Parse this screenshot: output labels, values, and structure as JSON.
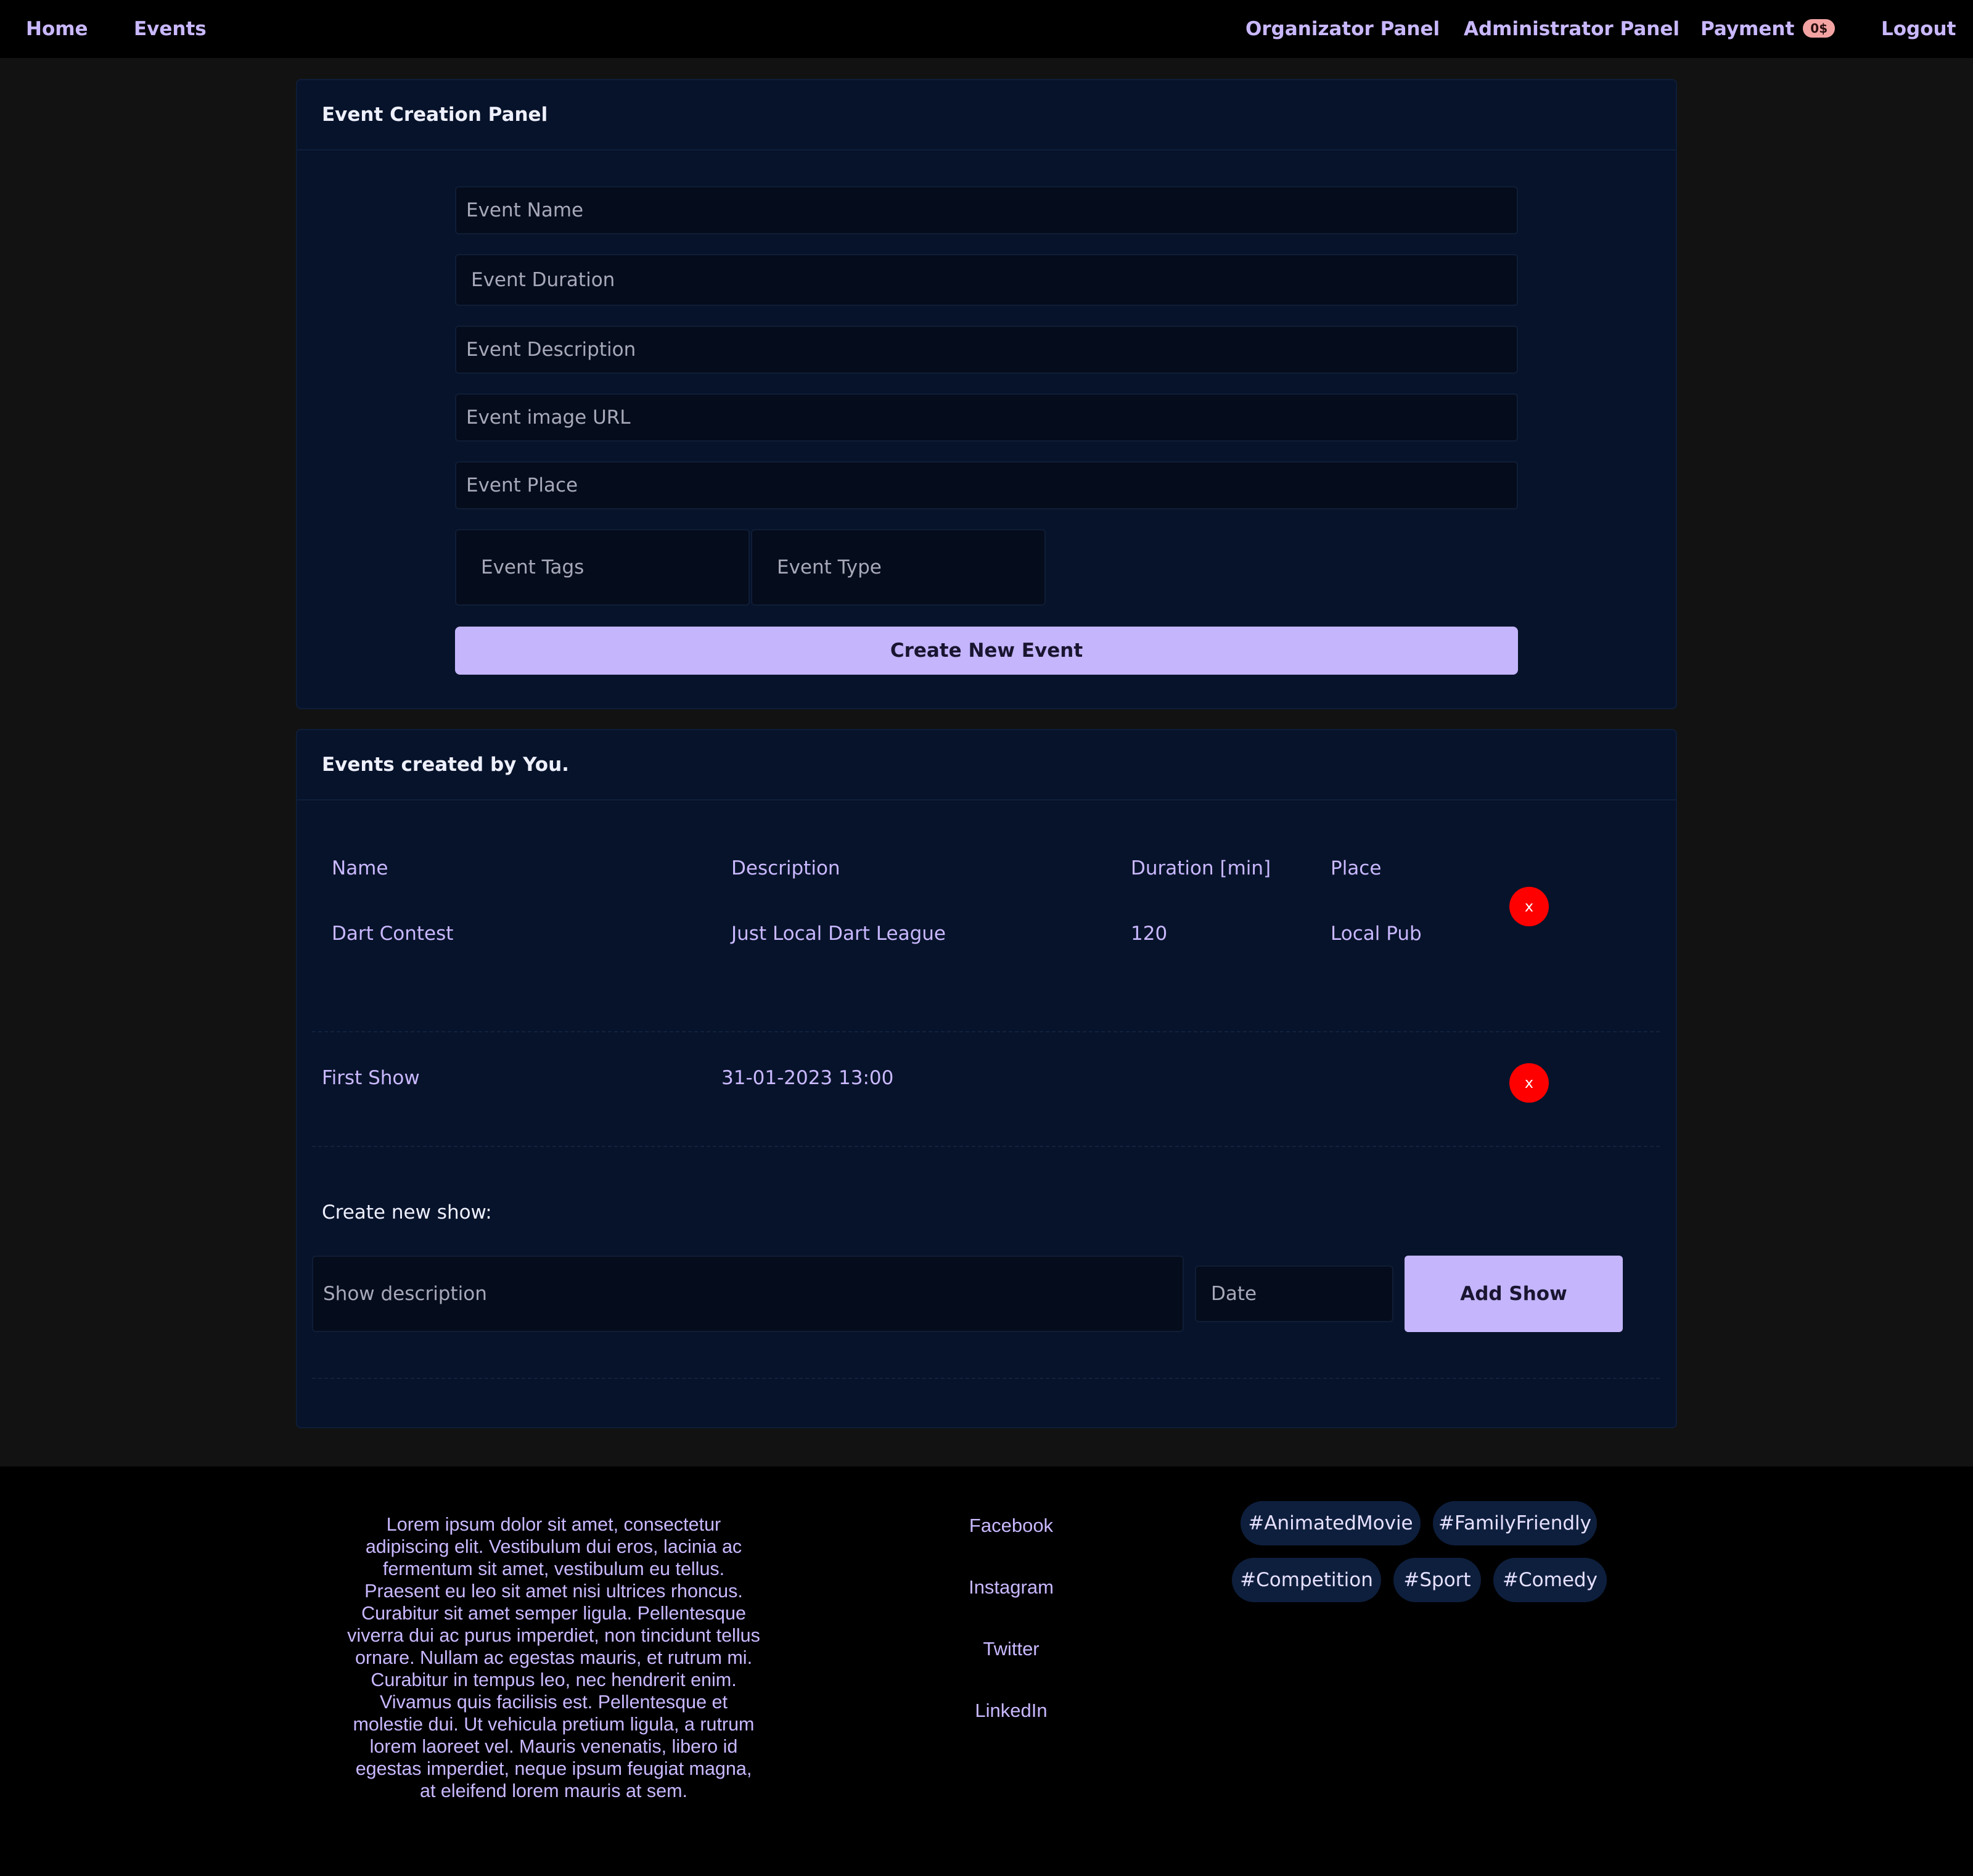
{
  "nav": {
    "home": "Home",
    "events": "Events",
    "organizator_panel": "Organizator Panel",
    "administrator_panel": "Administrator Panel",
    "payment": "Payment",
    "payment_badge": "0$",
    "logout": "Logout"
  },
  "creation_panel": {
    "title": "Event Creation Panel",
    "placeholders": {
      "name": "Event Name",
      "duration": "Event Duration",
      "description": "Event Description",
      "image_url": "Event image URL",
      "place": "Event Place",
      "tags": "Event Tags",
      "type": "Event Type"
    },
    "submit_label": "Create New Event"
  },
  "events_panel": {
    "title": "Events created by You.",
    "columns": [
      "Name",
      "Description",
      "Duration [min]",
      "Place"
    ],
    "event": {
      "name": "Dart Contest",
      "description": "Just Local Dart League",
      "duration": "120",
      "place": "Local Pub"
    },
    "delete_label": "x",
    "shows": [
      {
        "name": "First Show",
        "date": "31-01-2023 13:00"
      }
    ],
    "create_show_label": "Create new show:",
    "show_description_placeholder": "Show description",
    "date_placeholder": "Date",
    "add_show_label": "Add Show"
  },
  "footer": {
    "lorem": "Lorem ipsum dolor sit amet, consectetur adipiscing elit. Vestibulum dui eros, lacinia ac fermentum sit amet, vestibulum eu tellus. Praesent eu leo sit amet nisi ultrices rhoncus. Curabitur sit amet semper ligula. Pellentesque viverra dui ac purus imperdiet, non tincidunt tellus ornare. Nullam ac egestas mauris, et rutrum mi. Curabitur in tempus leo, nec hendrerit enim. Vivamus quis facilisis est. Pellentesque et molestie dui. Ut vehicula pretium ligula, a rutrum lorem laoreet vel. Mauris venenatis, libero id egestas imperdiet, neque ipsum feugiat magna, at eleifend lorem mauris at sem.",
    "social": [
      "Facebook",
      "Instagram",
      "Twitter",
      "LinkedIn"
    ],
    "tags": [
      "#AnimatedMovie",
      "#FamilyFriendly",
      "#Competition",
      "#Sport",
      "#Comedy"
    ]
  },
  "colors": {
    "page_bg": "#121212",
    "nav_bg": "#000000",
    "card_bg": "#07132a",
    "accent": "#c4b5fd",
    "link_text": "#c9b8ff",
    "delete": "#ff0000",
    "badge": "#f4a3a3",
    "tag_bg": "#0e1f3d"
  }
}
